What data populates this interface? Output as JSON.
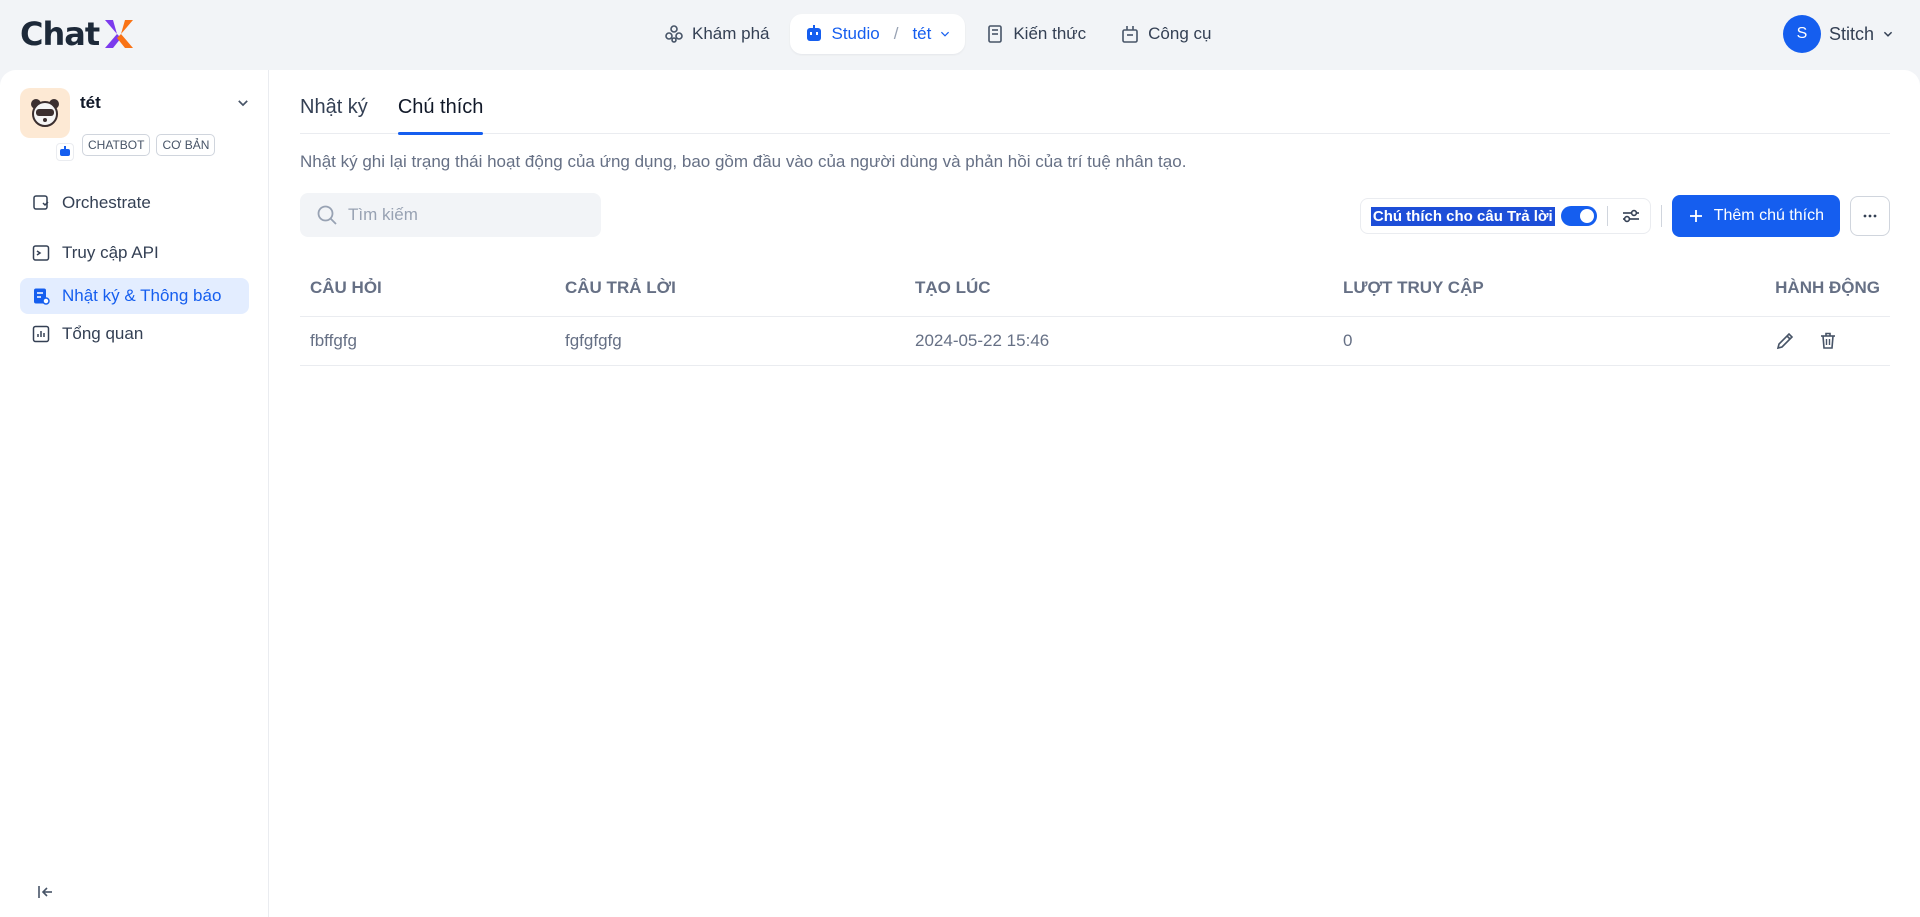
{
  "brand": {
    "name": "Chat"
  },
  "nav": {
    "items": [
      {
        "label": "Khám phá"
      },
      {
        "label": "Studio",
        "sub": "tét"
      },
      {
        "label": "Kiến thức"
      },
      {
        "label": "Công cụ"
      }
    ],
    "separator": "/"
  },
  "user": {
    "initial": "S",
    "name": "Stitch"
  },
  "app": {
    "name": "tét",
    "tags": [
      "Chatbot",
      "Cơ bản"
    ]
  },
  "sidebar": {
    "items": [
      {
        "label": "Orchestrate"
      },
      {
        "label": "Truy cập API"
      },
      {
        "label": "Nhật ký & Thông báo"
      },
      {
        "label": "Tổng quan"
      }
    ]
  },
  "tabs": [
    {
      "label": "Nhật ký"
    },
    {
      "label": "Chú thích"
    }
  ],
  "description": "Nhật ký ghi lại trạng thái hoạt động của ứng dụng, bao gồm đầu vào của người dùng và phản hồi của trí tuệ nhân tạo.",
  "search": {
    "placeholder": "Tìm kiếm"
  },
  "toolbar": {
    "toggle_label": "Chú thích cho câu Trả lời",
    "toggle_on": true,
    "add_label": "Thêm chú thích"
  },
  "table": {
    "columns": [
      "Câu hỏi",
      "Câu trả lời",
      "Tạo lúc",
      "Lượt truy cập",
      "Hành động"
    ],
    "rows": [
      {
        "question": "fbffgfg",
        "answer": "fgfgfgfg",
        "created": "2024-05-22 15:46",
        "hits": "0"
      }
    ]
  },
  "colors": {
    "accent": "#155eef",
    "active_bg": "#e3edff",
    "page_bg": "#f2f4f7"
  }
}
